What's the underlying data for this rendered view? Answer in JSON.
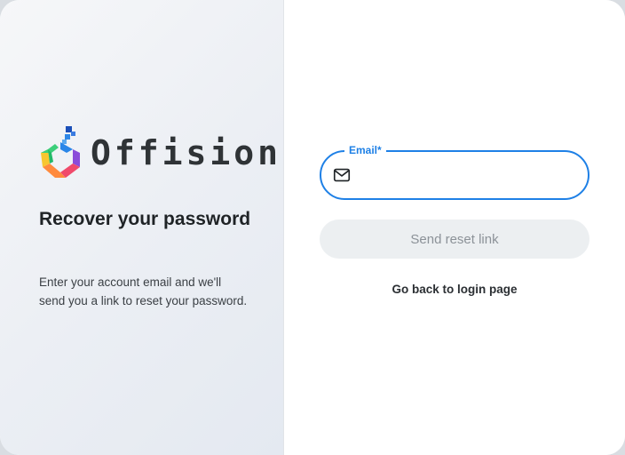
{
  "brand": {
    "name": "Offision",
    "logo_icon": "hexagon-logo-icon"
  },
  "intro": {
    "heading": "Recover your password",
    "description": "Enter your account email and we'll send you a link to reset your password."
  },
  "form": {
    "email_label": "Email",
    "required_marker": "*",
    "email_value": "",
    "email_icon": "mail-icon",
    "submit_label": "Send reset link",
    "back_link_label": "Go back to login page"
  },
  "colors": {
    "accent": "#1e80e6",
    "disabled_button_bg": "#eceff1",
    "disabled_button_text": "#8c9298"
  }
}
